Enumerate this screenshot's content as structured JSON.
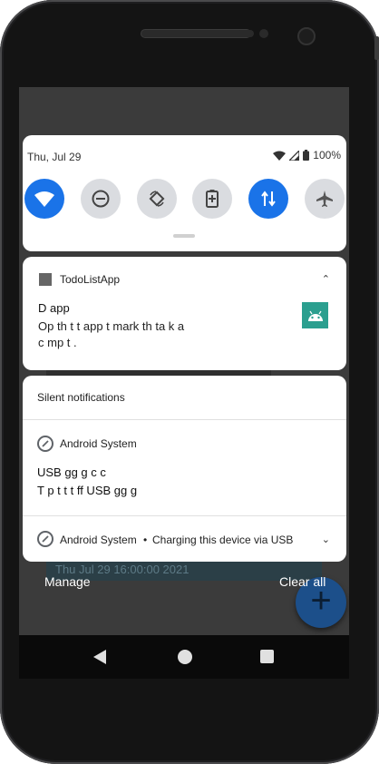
{
  "status_bar": {
    "date": "Thu, Jul 29",
    "battery": "100%"
  },
  "quick_settings": {
    "tiles": [
      {
        "name": "wifi",
        "state": "on"
      },
      {
        "name": "do-not-disturb",
        "state": "off"
      },
      {
        "name": "auto-rotate",
        "state": "off"
      },
      {
        "name": "battery-saver",
        "state": "off"
      },
      {
        "name": "mobile-data",
        "state": "on"
      },
      {
        "name": "airplane-mode",
        "state": "off"
      }
    ]
  },
  "todo_notification": {
    "app_name": "TodoListApp",
    "title": "D    app",
    "line1": "Op     th  t          t app t    mark th    ta  k a",
    "line2": "c    mp    t   ."
  },
  "silent_section": {
    "header": "Silent notifications",
    "usb_debug": {
      "app_name": "Android System",
      "line1": "USB            gg   g c           c",
      "line2": "T   p t    t    t    ff USB            gg   g"
    },
    "charging": {
      "app_name": "Android System",
      "separator": "•",
      "text": "Charging this device via USB"
    }
  },
  "footer": {
    "manage": "Manage",
    "clear_all": "Clear all"
  },
  "background": {
    "list_row_text": "Thu Jul 29 16:00:00 2021",
    "fab_label": "+"
  },
  "colors": {
    "accent": "#1a73e8",
    "tile_off": "#dadce0",
    "app_icon": "#2b9f8f"
  }
}
